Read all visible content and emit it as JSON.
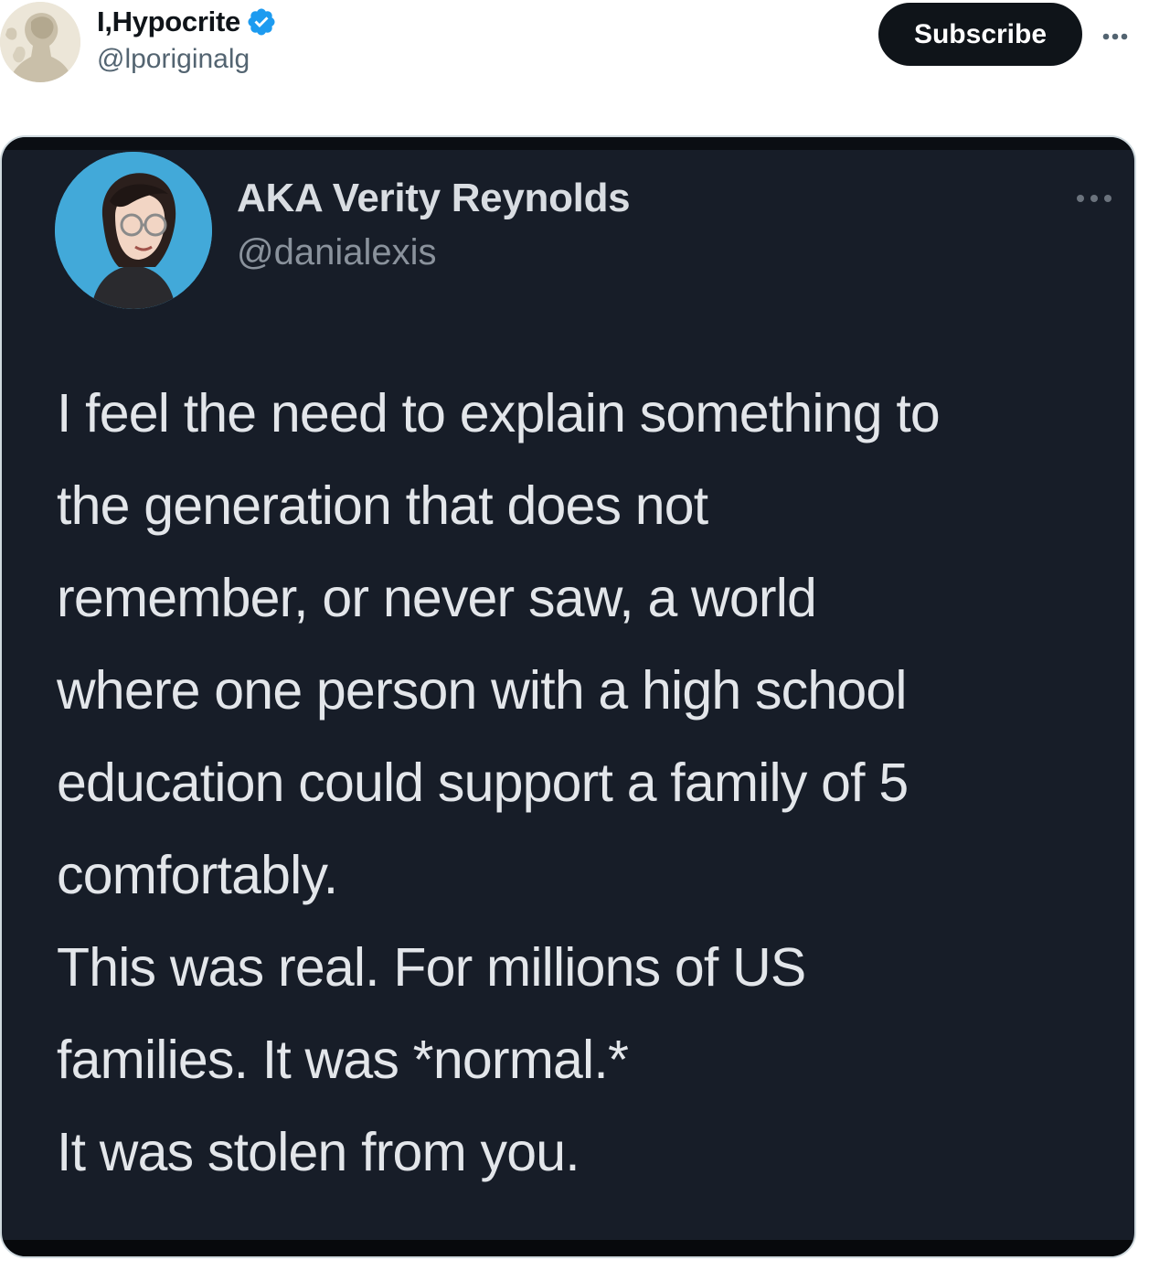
{
  "tweet": {
    "author": {
      "name": "I,Hypocrite",
      "handle": "@lporiginalg",
      "verified": true,
      "verified_color": "#1d9bf0"
    },
    "subscribe_label": "Subscribe",
    "more_icon": "more-horizontal-icon"
  },
  "embedded": {
    "author": {
      "name": "AKA Verity Reynolds",
      "handle": "@danialexis",
      "avatar_bg": "#42a9d9"
    },
    "lines": [
      "I feel the need to explain something to",
      "the generation that does not",
      "remember, or never saw, a world",
      "where one person with a high school",
      "education could support a family of 5",
      "comfortably.",
      "This was real. For millions of US",
      "families. It was *normal.*",
      "It was stolen from you."
    ],
    "background": "#171d28"
  }
}
